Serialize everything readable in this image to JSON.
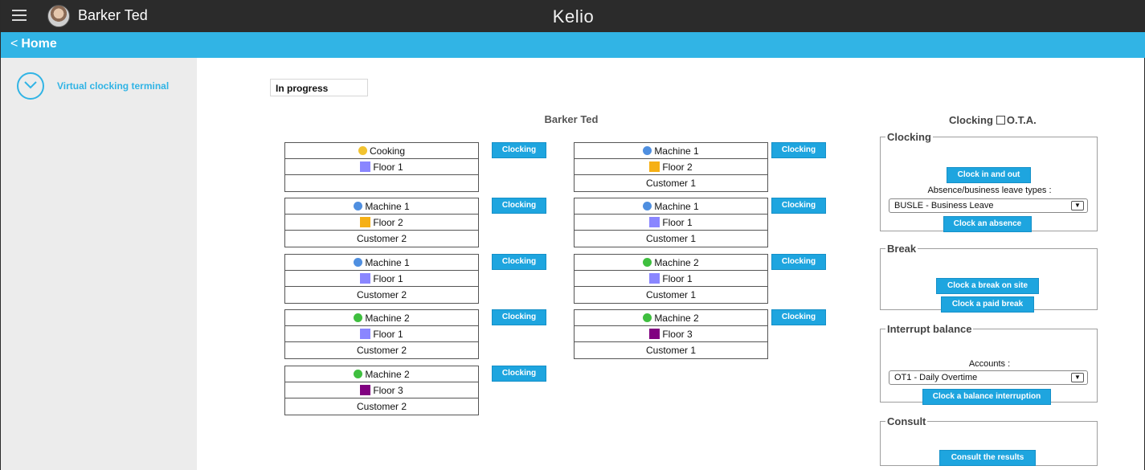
{
  "header": {
    "user_name": "Barker Ted",
    "brand": "Kelio"
  },
  "nav": {
    "home_chevron": "<",
    "home_label": "Home"
  },
  "sidebar": {
    "items": [
      {
        "label": "Virtual clocking terminal",
        "icon": "clock-chevron-icon"
      }
    ]
  },
  "main": {
    "status": "In progress",
    "employee": "Barker Ted",
    "clocking_button": "Clocking",
    "cards": [
      {
        "activity": "Cooking",
        "activity_color": "#f2c330",
        "location": "Floor 1",
        "location_color": "#8a86ff",
        "customer": ""
      },
      {
        "activity": "Machine 1",
        "activity_color": "#4f8fe0",
        "location": "Floor 2",
        "location_color": "#f6b015",
        "customer": "Customer 2"
      },
      {
        "activity": "Machine 1",
        "activity_color": "#4f8fe0",
        "location": "Floor 1",
        "location_color": "#8a86ff",
        "customer": "Customer 2"
      },
      {
        "activity": "Machine 2",
        "activity_color": "#3fbf3f",
        "location": "Floor 1",
        "location_color": "#8a86ff",
        "customer": "Customer 2"
      },
      {
        "activity": "Machine 2",
        "activity_color": "#3fbf3f",
        "location": "Floor 3",
        "location_color": "#800080",
        "customer": "Customer 2"
      },
      {
        "activity": "Machine 1",
        "activity_color": "#4f8fe0",
        "location": "Floor 2",
        "location_color": "#f6b015",
        "customer": "Customer 1"
      },
      {
        "activity": "Machine 1",
        "activity_color": "#4f8fe0",
        "location": "Floor 1",
        "location_color": "#8a86ff",
        "customer": "Customer 1"
      },
      {
        "activity": "Machine 2",
        "activity_color": "#3fbf3f",
        "location": "Floor 1",
        "location_color": "#8a86ff",
        "customer": "Customer 1"
      },
      {
        "activity": "Machine 2",
        "activity_color": "#3fbf3f",
        "location": "Floor 3",
        "location_color": "#800080",
        "customer": "Customer 1"
      }
    ]
  },
  "panel": {
    "title": "Clocking",
    "ota_label": "O.T.A.",
    "clocking": {
      "legend": "Clocking",
      "clock_in_out": "Clock in and out",
      "absence_label": "Absence/business leave types :",
      "absence_value": "BUSLE - Business Leave",
      "clock_absence": "Clock an absence"
    },
    "break": {
      "legend": "Break",
      "break_on_site": "Clock a break on site",
      "paid_break": "Clock a paid break"
    },
    "interrupt": {
      "legend": "Interrupt balance",
      "accounts_label": "Accounts :",
      "accounts_value": "OT1 - Daily Overtime",
      "balance_interruption": "Clock a balance interruption"
    },
    "consult": {
      "legend": "Consult",
      "consult_results": "Consult the results"
    }
  }
}
